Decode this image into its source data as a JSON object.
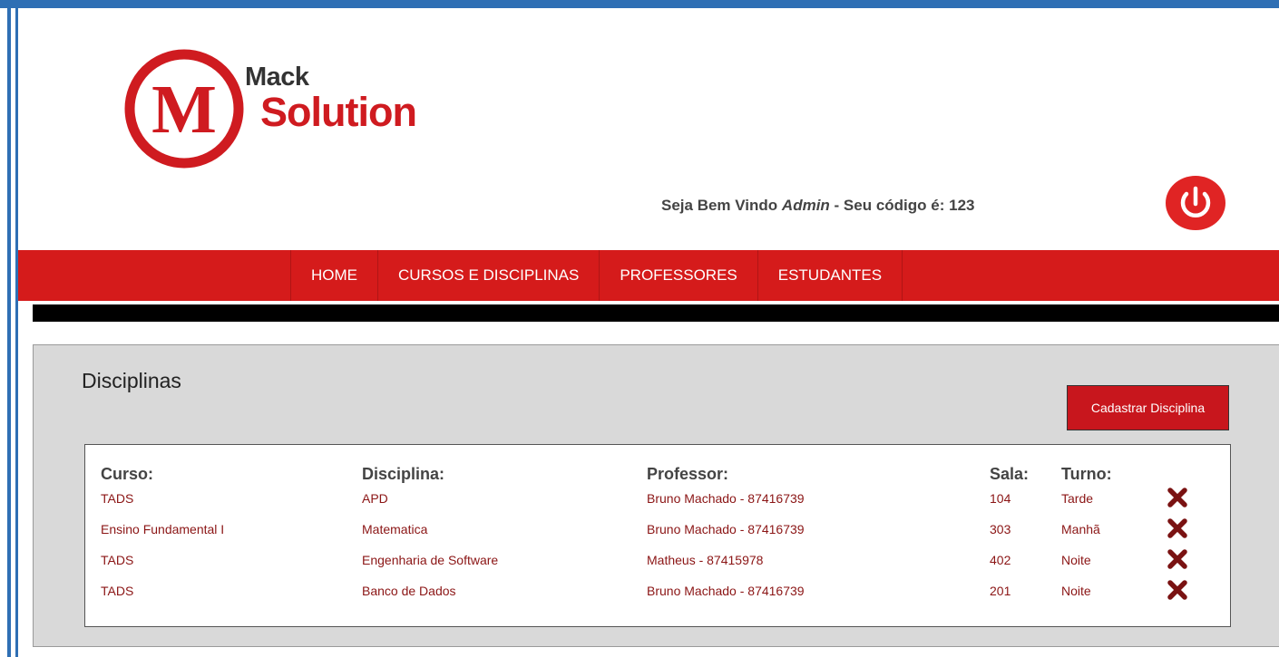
{
  "brand": {
    "line1": "Mack",
    "line2": "Solution",
    "logo_letter": "M"
  },
  "header": {
    "welcome_prefix": "Seja Bem Vindo",
    "user": "Admin",
    "welcome_suffix": "- Seu código é: 123"
  },
  "nav": {
    "items": [
      "HOME",
      "CURSOS E DISCIPLINAS",
      "PROFESSORES",
      "ESTUDANTES"
    ]
  },
  "page": {
    "title": "Disciplinas",
    "add_button": "Cadastrar Disciplina"
  },
  "table": {
    "headers": [
      "Curso:",
      "Disciplina:",
      "Professor:",
      "Sala:",
      "Turno:"
    ],
    "rows": [
      [
        "TADS",
        "APD",
        "Bruno Machado - 87416739",
        "104",
        "Tarde"
      ],
      [
        "Ensino Fundamental I",
        "Matematica",
        "Bruno Machado - 87416739",
        "303",
        "Manhã"
      ],
      [
        "TADS",
        "Engenharia de Software",
        "Matheus - 87415978",
        "402",
        "Noite"
      ],
      [
        "TADS",
        "Banco de Dados",
        "Bruno Machado - 87416739",
        "201",
        "Noite"
      ]
    ]
  },
  "colors": {
    "brand_red": "#d51b1b",
    "frame_blue": "#2f6fb4",
    "cell_text": "#8b1515"
  },
  "icons": {
    "power": "power-icon",
    "delete": "delete-x-icon"
  }
}
